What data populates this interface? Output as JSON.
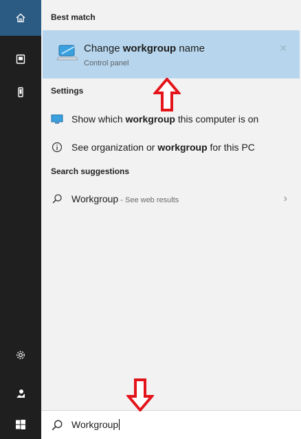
{
  "sections": {
    "best_match": "Best match",
    "settings": "Settings",
    "search_suggestions": "Search suggestions"
  },
  "best_match_item": {
    "title_pre": "Change ",
    "title_bold": "workgroup",
    "title_post": " name",
    "subtitle": "Control panel",
    "close": "✕"
  },
  "settings_items": [
    {
      "pre": "Show which ",
      "bold": "workgroup",
      "post": " this computer is on",
      "icon": "monitor-icon"
    },
    {
      "pre": "See organization or ",
      "bold": "workgroup",
      "post": " for this PC",
      "icon": "info-icon"
    }
  ],
  "suggestion": {
    "text": "Workgroup",
    "sub": " - See web results",
    "chevron": "›",
    "icon": "search-icon"
  },
  "search": {
    "value": "Workgroup"
  },
  "rail": {
    "home": "home-icon",
    "documents": "documents-icon",
    "pictures": "phone-icon",
    "settings": "gear-icon",
    "feedback": "feedback-icon",
    "start": "windows-logo-icon"
  },
  "colors": {
    "rail_bg": "#1f1f1f",
    "home_accent": "#2b5a83",
    "panel_bg": "#f2f2f2",
    "selected_bg": "#b7d6ed",
    "annotation_red": "#e3151b"
  }
}
